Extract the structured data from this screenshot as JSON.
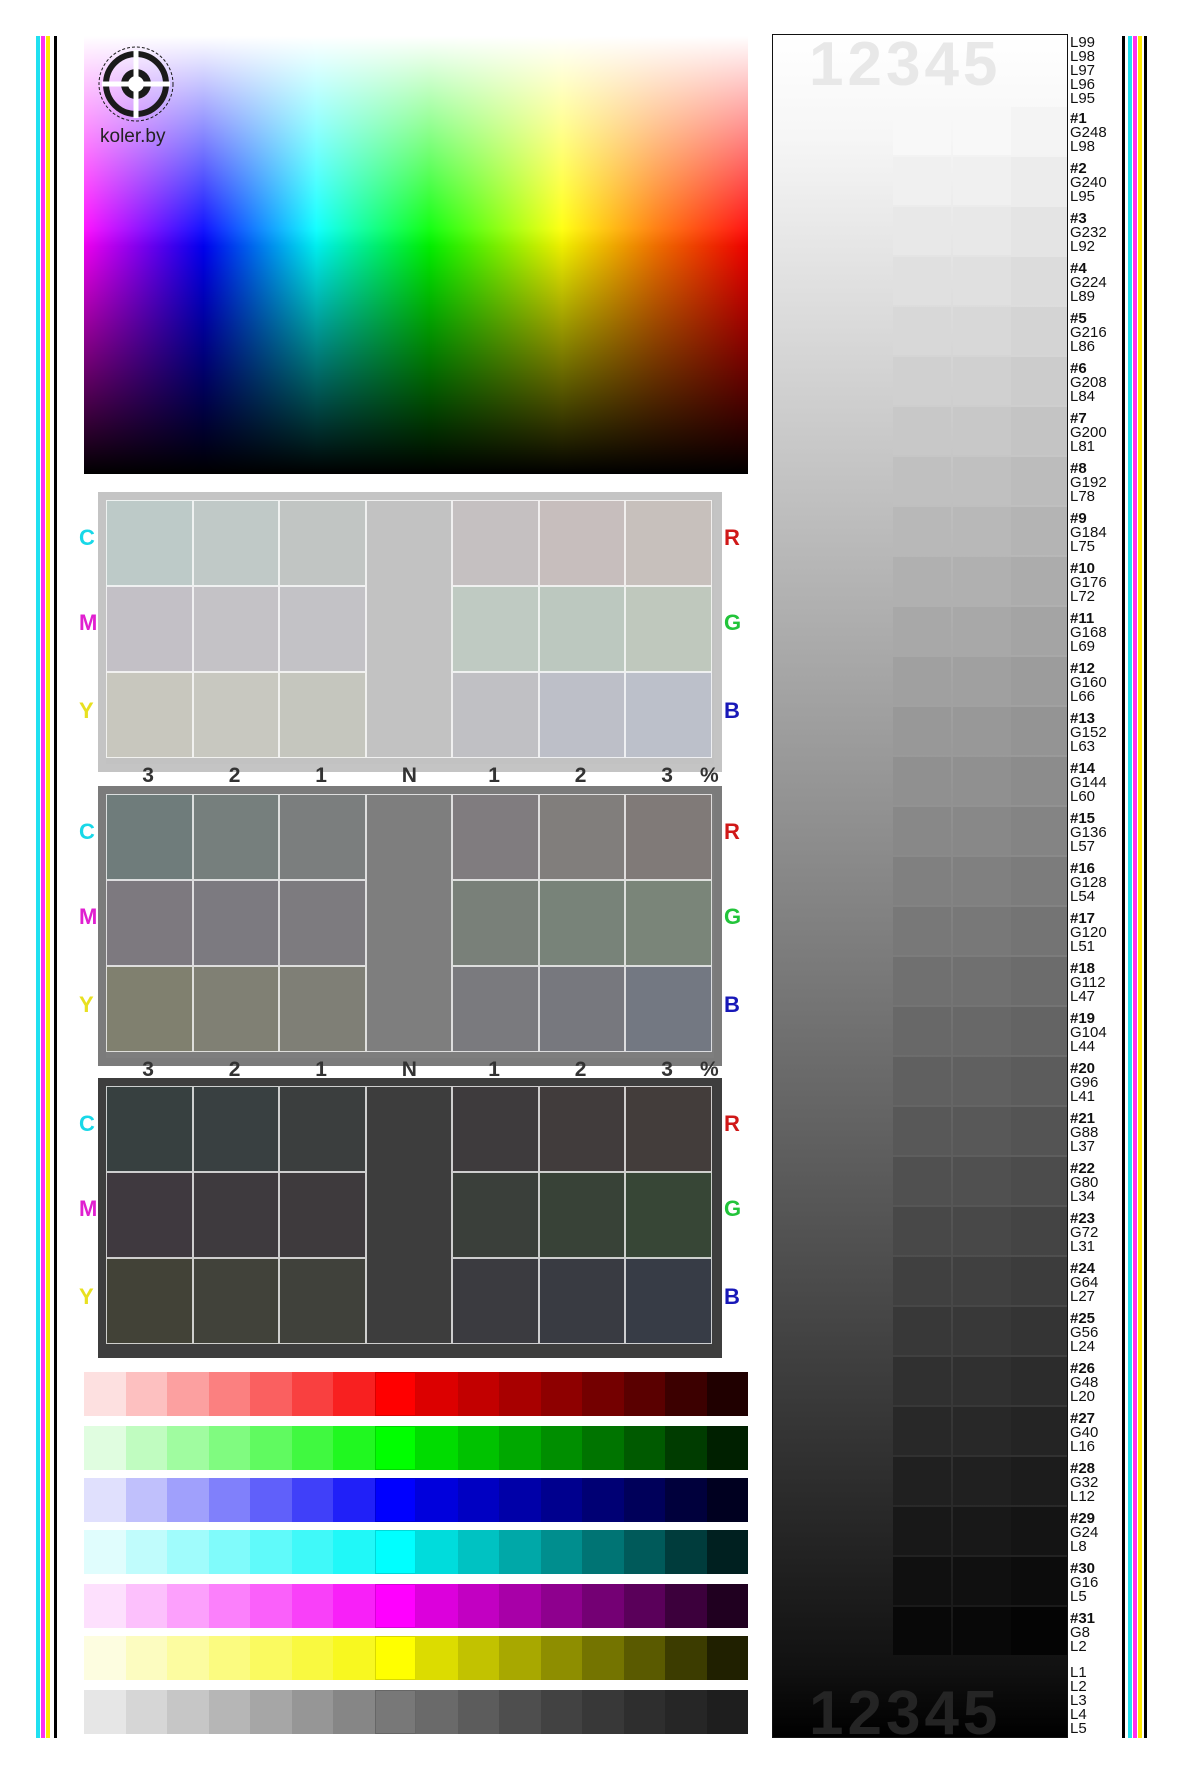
{
  "logo": {
    "text": "koler.by",
    "ring_text": "ЦВЕТОВОЕ ПРОФИЛИРОВАНИЕ УСТРОЙСТВ"
  },
  "panels": {
    "left_labels": [
      "C",
      "M",
      "Y"
    ],
    "right_labels": [
      "R",
      "G",
      "B"
    ],
    "scale_labels": [
      "3",
      "2",
      "1",
      "N",
      "1",
      "2",
      "3",
      "%"
    ],
    "label_colors": {
      "C": "#18d8e8",
      "M": "#e020d0",
      "Y": "#e8e020",
      "R": "#d01818",
      "G": "#22c43a",
      "B": "#1818b8"
    },
    "items": [
      {
        "name": "light",
        "frame": "#c4c4c4",
        "neutral": "#c2c2c2",
        "rows": [
          [
            "#bdcac8",
            "#c0c9c7",
            "#c1c5c3",
            "#c5c0c1",
            "#c7bebd",
            "#c7c0bc"
          ],
          [
            "#c3c0c6",
            "#c4c2c6",
            "#c3c2c6",
            "#bfcac2",
            "#bcc8bf",
            "#bfc8bd"
          ],
          [
            "#c8c7be",
            "#c8c8c0",
            "#c5c6be",
            "#c0c0c4",
            "#bdbfc8",
            "#bcc0ca"
          ]
        ]
      },
      {
        "name": "medium",
        "frame": "#7b7b7b",
        "neutral": "#7e7e7e",
        "rows": [
          [
            "#6f7c7b",
            "#767f7d",
            "#7b7e7e",
            "#807c7f",
            "#817e7c",
            "#807a78"
          ],
          [
            "#7d797f",
            "#7c7a80",
            "#7d7b7f",
            "#798079",
            "#788379",
            "#7a8579"
          ],
          [
            "#80806f",
            "#808074",
            "#7f7f76",
            "#7a7a7e",
            "#77787e",
            "#737882"
          ]
        ]
      },
      {
        "name": "dark",
        "frame": "#3e3e3e",
        "neutral": "#3d3d3d",
        "rows": [
          [
            "#374040",
            "#394041",
            "#3b3e3e",
            "#3e3b3d",
            "#413c3c",
            "#433d3b"
          ],
          [
            "#3f393f",
            "#3e3a3e",
            "#3e3a3d",
            "#3a3f3a",
            "#384237",
            "#374636"
          ],
          [
            "#424237",
            "#41423a",
            "#40413b",
            "#3b3b40",
            "#393b42",
            "#373c46"
          ]
        ]
      }
    ]
  },
  "color_strips": [
    {
      "name": "red-strip",
      "colors": [
        "#fde0e0",
        "#fdc0c0",
        "#fca0a0",
        "#fb8080",
        "#fa6060",
        "#f94040",
        "#f82020",
        "#ff0000",
        "#dc0000",
        "#c20000",
        "#a80000",
        "#8e0000",
        "#740000",
        "#5a0000",
        "#3c0000",
        "#200000"
      ]
    },
    {
      "name": "green-strip",
      "colors": [
        "#e0fde0",
        "#c0fcc0",
        "#a0fca0",
        "#80fb80",
        "#60fa60",
        "#40f940",
        "#20f820",
        "#00ff00",
        "#00dc00",
        "#00c200",
        "#00a800",
        "#008e00",
        "#007400",
        "#005a00",
        "#003c00",
        "#002000"
      ]
    },
    {
      "name": "blue-strip",
      "colors": [
        "#e0e0fd",
        "#c0c0fc",
        "#a0a0fc",
        "#8080fb",
        "#6060fa",
        "#4040f9",
        "#2020f8",
        "#0000ff",
        "#0000dc",
        "#0000c2",
        "#0000a8",
        "#00008e",
        "#000074",
        "#00005a",
        "#00003c",
        "#000020"
      ]
    },
    {
      "name": "cyan-strip",
      "colors": [
        "#e0fdfd",
        "#c0fcfc",
        "#a0fcfc",
        "#80fbfb",
        "#60fafa",
        "#40f9f9",
        "#20f8f8",
        "#00ffff",
        "#00dcdc",
        "#00c2c2",
        "#00a8a8",
        "#008e8e",
        "#007474",
        "#005a5a",
        "#003c3c",
        "#002020"
      ]
    },
    {
      "name": "magenta-strip",
      "colors": [
        "#fde0fd",
        "#fcc0fc",
        "#fca0fc",
        "#fb80fb",
        "#fa60fa",
        "#f940f9",
        "#f820f8",
        "#ff00ff",
        "#dc00dc",
        "#c200c2",
        "#a800a8",
        "#8e008e",
        "#740074",
        "#5a005a",
        "#3c003c",
        "#200020"
      ]
    },
    {
      "name": "yellow-strip",
      "colors": [
        "#fdfde0",
        "#fcfcc0",
        "#fcfca0",
        "#fbfb80",
        "#fafa60",
        "#f9f940",
        "#f8f820",
        "#ffff00",
        "#dcdc00",
        "#c2c200",
        "#a8a800",
        "#8e8e00",
        "#747400",
        "#5a5a00",
        "#3c3c00",
        "#202000"
      ]
    },
    {
      "name": "gray-strip",
      "colors": [
        "#e6e6e6",
        "#d6d6d6",
        "#c6c6c6",
        "#b6b6b6",
        "#a6a6a6",
        "#969696",
        "#868686",
        "#787878",
        "#6a6a6a",
        "#5c5c5c",
        "#4e4e4e",
        "#424242",
        "#383838",
        "#2e2e2e",
        "#262626",
        "#1e1e1e"
      ]
    }
  ],
  "ramp": {
    "numbers": "12345",
    "top_labels": [
      "L99",
      "L98",
      "L97",
      "L96",
      "L95"
    ],
    "bottom_labels": [
      "L1",
      "L2",
      "L3",
      "L4",
      "L5"
    ],
    "patches": [
      {
        "id": "#1",
        "g": "G248",
        "l": "L98",
        "gray": 248
      },
      {
        "id": "#2",
        "g": "G240",
        "l": "L95",
        "gray": 240
      },
      {
        "id": "#3",
        "g": "G232",
        "l": "L92",
        "gray": 232
      },
      {
        "id": "#4",
        "g": "G224",
        "l": "L89",
        "gray": 224
      },
      {
        "id": "#5",
        "g": "G216",
        "l": "L86",
        "gray": 216
      },
      {
        "id": "#6",
        "g": "G208",
        "l": "L84",
        "gray": 208
      },
      {
        "id": "#7",
        "g": "G200",
        "l": "L81",
        "gray": 200
      },
      {
        "id": "#8",
        "g": "G192",
        "l": "L78",
        "gray": 192
      },
      {
        "id": "#9",
        "g": "G184",
        "l": "L75",
        "gray": 184
      },
      {
        "id": "#10",
        "g": "G176",
        "l": "L72",
        "gray": 176
      },
      {
        "id": "#11",
        "g": "G168",
        "l": "L69",
        "gray": 168
      },
      {
        "id": "#12",
        "g": "G160",
        "l": "L66",
        "gray": 160
      },
      {
        "id": "#13",
        "g": "G152",
        "l": "L63",
        "gray": 152
      },
      {
        "id": "#14",
        "g": "G144",
        "l": "L60",
        "gray": 144
      },
      {
        "id": "#15",
        "g": "G136",
        "l": "L57",
        "gray": 136
      },
      {
        "id": "#16",
        "g": "G128",
        "l": "L54",
        "gray": 128
      },
      {
        "id": "#17",
        "g": "G120",
        "l": "L51",
        "gray": 120
      },
      {
        "id": "#18",
        "g": "G112",
        "l": "L47",
        "gray": 112
      },
      {
        "id": "#19",
        "g": "G104",
        "l": "L44",
        "gray": 104
      },
      {
        "id": "#20",
        "g": "G96",
        "l": "L41",
        "gray": 96
      },
      {
        "id": "#21",
        "g": "G88",
        "l": "L37",
        "gray": 88
      },
      {
        "id": "#22",
        "g": "G80",
        "l": "L34",
        "gray": 80
      },
      {
        "id": "#23",
        "g": "G72",
        "l": "L31",
        "gray": 72
      },
      {
        "id": "#24",
        "g": "G64",
        "l": "L27",
        "gray": 64
      },
      {
        "id": "#25",
        "g": "G56",
        "l": "L24",
        "gray": 56
      },
      {
        "id": "#26",
        "g": "G48",
        "l": "L20",
        "gray": 48
      },
      {
        "id": "#27",
        "g": "G40",
        "l": "L16",
        "gray": 40
      },
      {
        "id": "#28",
        "g": "G32",
        "l": "L12",
        "gray": 32
      },
      {
        "id": "#29",
        "g": "G24",
        "l": "L8",
        "gray": 24
      },
      {
        "id": "#30",
        "g": "G16",
        "l": "L5",
        "gray": 16
      },
      {
        "id": "#31",
        "g": "G8",
        "l": "L2",
        "gray": 8
      }
    ]
  }
}
